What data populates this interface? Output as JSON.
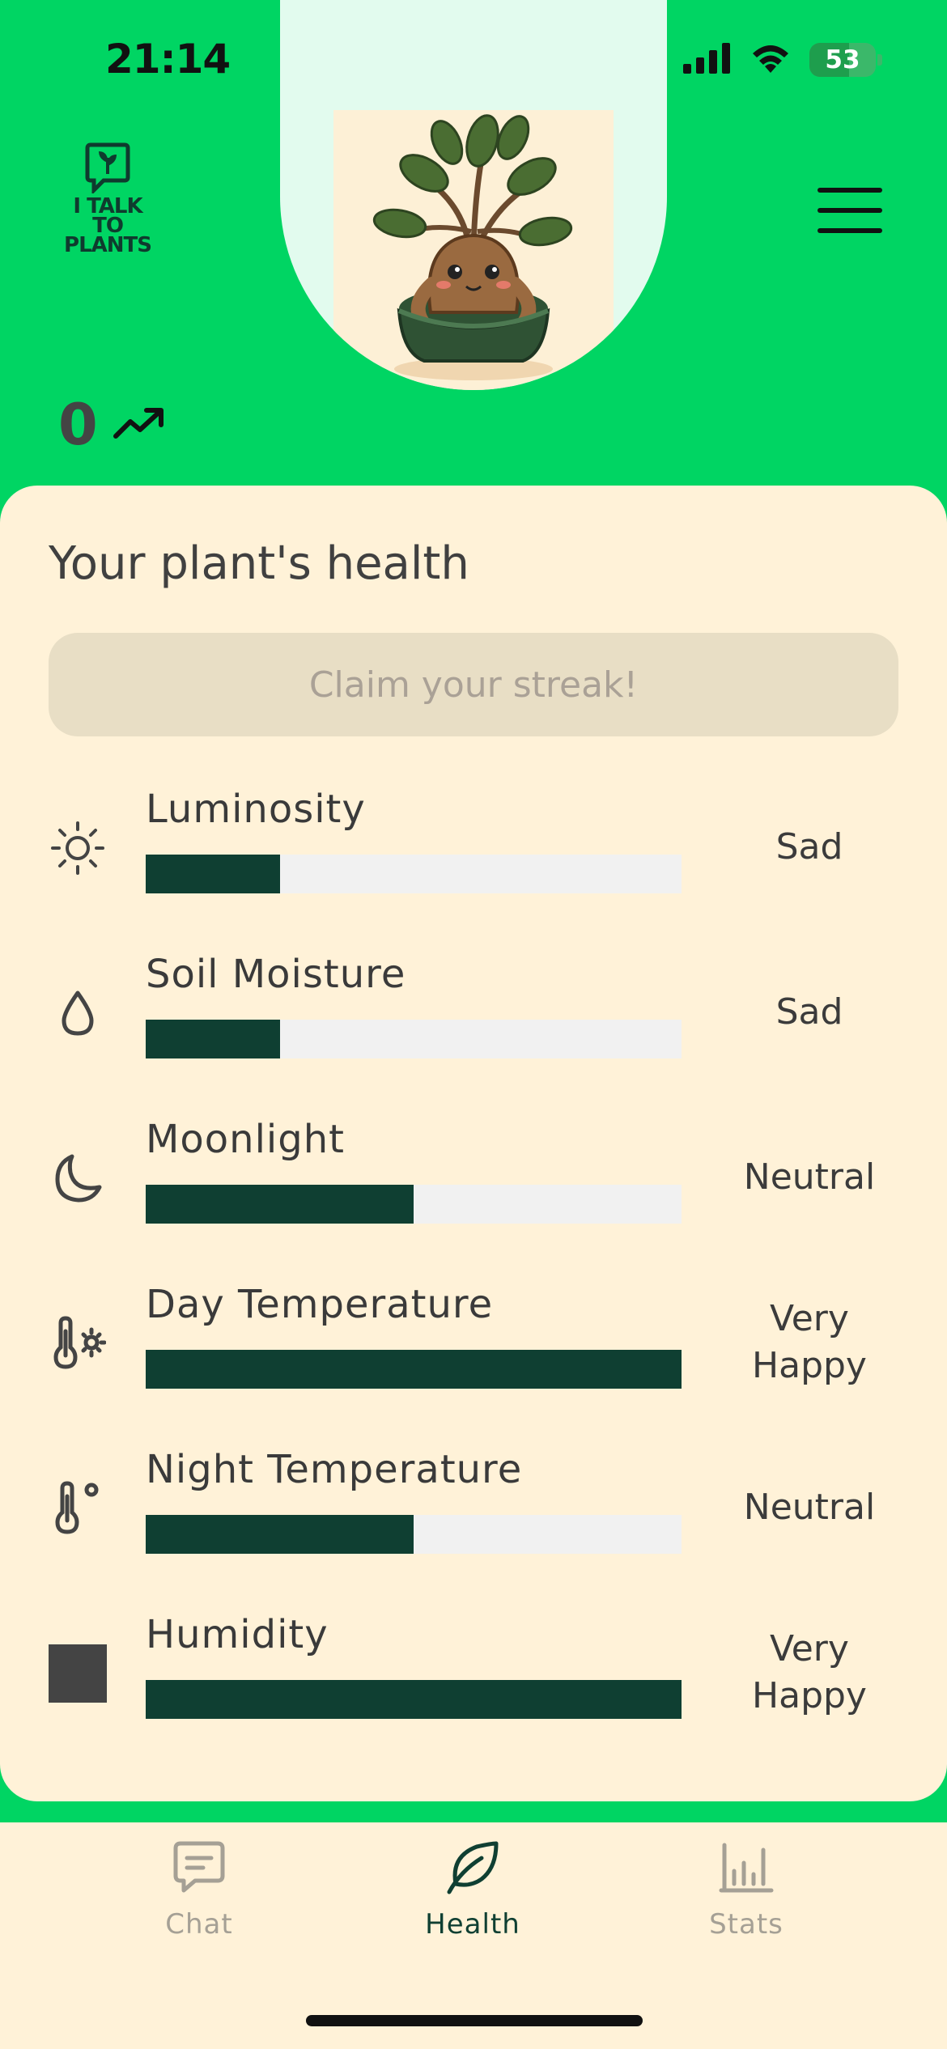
{
  "status_bar": {
    "time": "21:14",
    "battery": "53",
    "icons": [
      "cellular-signal-icon",
      "wifi-icon",
      "battery-charging-icon"
    ]
  },
  "header": {
    "logo_text": "I TALK\nTO\nPLANTS",
    "menu_icon": "hamburger-menu-icon",
    "streak_count": "0",
    "streak_icon": "trending-up-icon",
    "plant_image": "mandrake-plant-in-pot"
  },
  "card": {
    "title": "Your plant's health",
    "claim_button": "Claim your streak!",
    "metrics": [
      {
        "label": "Luminosity",
        "status": "Sad",
        "level": 0.25,
        "icon": "sun-icon"
      },
      {
        "label": "Soil Moisture",
        "status": "Sad",
        "level": 0.25,
        "icon": "water-drop-icon"
      },
      {
        "label": "Moonlight",
        "status": "Neutral",
        "level": 0.5,
        "icon": "moon-icon"
      },
      {
        "label": "Day Temperature",
        "status": "Very Happy",
        "level": 1.0,
        "icon": "thermometer-sun-icon"
      },
      {
        "label": "Night Temperature",
        "status": "Neutral",
        "level": 0.5,
        "icon": "thermometer-degree-icon"
      },
      {
        "label": "Humidity",
        "status": "Very Happy",
        "level": 1.0,
        "icon": "humidity-icon"
      }
    ]
  },
  "nav": {
    "items": [
      {
        "label": "Chat",
        "icon": "chat-bubble-icon",
        "active": false
      },
      {
        "label": "Health",
        "icon": "leaf-icon",
        "active": true
      },
      {
        "label": "Stats",
        "icon": "bar-chart-icon",
        "active": false
      }
    ]
  },
  "colors": {
    "header_green": "#00D563",
    "card_cream": "#FFF2D8",
    "bar_fill": "#0F3F32",
    "bar_track": "#F1F1F1",
    "claim_button_bg": "#E8DEC5"
  }
}
